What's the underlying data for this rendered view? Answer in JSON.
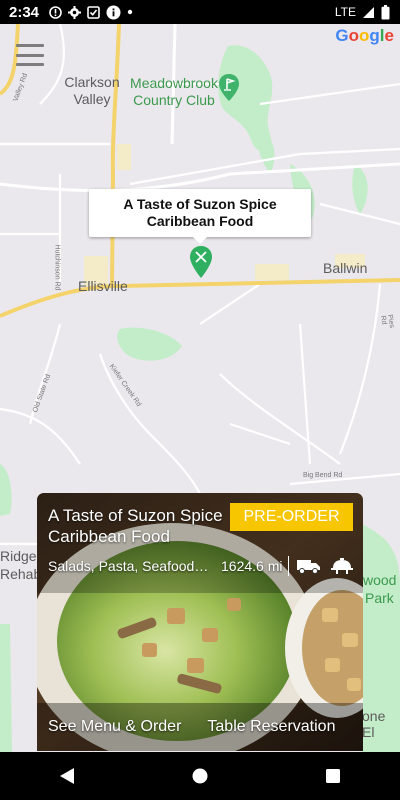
{
  "status_bar": {
    "time": "2:34",
    "network": "LTE",
    "icons": [
      "alert-circle-icon",
      "settings-gear-icon",
      "check-box-icon",
      "info-icon",
      "dot-icon"
    ]
  },
  "map": {
    "labels": {
      "clarkson": "Clarkson Valley",
      "meadowbrook": "Meadowbrook Country Club",
      "ellisville": "Ellisville",
      "ballwin": "Ballwin",
      "ridge": "Ridge",
      "rehab": "Rehab",
      "wood": "wood",
      "park": "Park",
      "one_el": "one El",
      "valley_rd": "Valley Rd",
      "hutchinson_rd": "Hutchinson Rd",
      "old_state_rd": "Old State Rd",
      "kiefer_creek_rd": "Kiefer Creek Rd",
      "big_bend_rd": "Big Bend Rd",
      "pies_rd": "Pies Rd"
    },
    "google_logo": [
      "G",
      "o",
      "o",
      "g",
      "l",
      "e"
    ]
  },
  "info_window": {
    "line1": "A Taste of Suzon Spice",
    "line2": "Caribbean Food"
  },
  "card": {
    "title": "A Taste of Suzon Spice Caribbean Food",
    "preorder_label": "PRE-ORDER",
    "tags": "Salads, Pasta, Seafood, ...",
    "distance": "1624.6 mi",
    "see_menu_label": "See Menu & Order",
    "table_reservation_label": "Table Reservation",
    "service_icons": [
      "delivery-truck-icon",
      "dine-in-cloche-icon"
    ]
  },
  "nav_bar": {
    "icons": [
      "back-icon",
      "home-icon",
      "recents-icon"
    ]
  },
  "colors": {
    "preorder": "#f7c600",
    "marker": "#2fb060",
    "map_bg": "#ebe8ed",
    "park": "#c3ecc9"
  }
}
